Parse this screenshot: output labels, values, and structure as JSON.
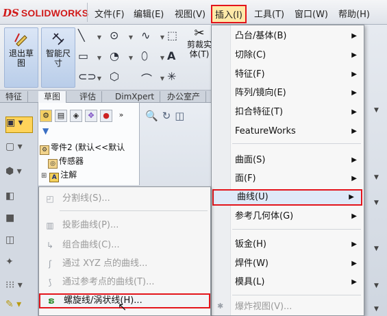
{
  "app": {
    "logo_mark": "DS",
    "logo_text": "SOLIDWORKS",
    "brand_color": "#d11a1a"
  },
  "menubar": {
    "items": [
      "文件(F)",
      "编辑(E)",
      "视图(V)",
      "插入(I)",
      "工具(T)",
      "窗口(W)",
      "帮助(H)"
    ],
    "active_index": 3,
    "highlight_color": "#e3141b"
  },
  "ribbon": {
    "exit_sketch": "退出草图",
    "smart_dim": "智能尺寸",
    "trim": "剪裁实体(T)"
  },
  "tabs": [
    "特征",
    "草图",
    "评估",
    "DimXpert",
    "办公室产"
  ],
  "tree": {
    "part": "零件2 (默认<<默认",
    "sensors": "传感器",
    "annotations": "注解"
  },
  "insert_menu": [
    {
      "label": "凸台/基体(B)",
      "submenu": true
    },
    {
      "label": "切除(C)",
      "submenu": true
    },
    {
      "label": "特征(F)",
      "submenu": true
    },
    {
      "label": "阵列/镜向(E)",
      "submenu": true
    },
    {
      "label": "扣合特征(T)",
      "submenu": true
    },
    {
      "label": "FeatureWorks",
      "submenu": true
    },
    {
      "label": "曲面(S)",
      "submenu": true
    },
    {
      "label": "面(F)",
      "submenu": true
    },
    {
      "label": "曲线(U)",
      "submenu": true,
      "highlighted": true
    },
    {
      "label": "参考几何体(G)",
      "submenu": true
    },
    {
      "label": "钣金(H)",
      "submenu": true
    },
    {
      "label": "焊件(W)",
      "submenu": true
    },
    {
      "label": "模具(L)",
      "submenu": true
    },
    {
      "label": "爆炸视图(V)...",
      "submenu": false,
      "disabled": true
    }
  ],
  "curves_submenu": [
    {
      "label": "分割线(S)...",
      "icon": "split-line-icon",
      "enabled": false
    },
    {
      "label": "投影曲线(P)...",
      "icon": "projected-curve-icon",
      "enabled": false
    },
    {
      "label": "组合曲线(C)...",
      "icon": "composite-curve-icon",
      "enabled": false
    },
    {
      "label": "通过 XYZ 点的曲线...",
      "icon": "xyz-curve-icon",
      "enabled": false
    },
    {
      "label": "通过参考点的曲线(T)...",
      "icon": "reference-point-curve-icon",
      "enabled": false
    },
    {
      "label": "螺旋线/涡状线(H)...",
      "icon": "helix-spiral-icon",
      "enabled": true,
      "highlighted": true
    }
  ]
}
